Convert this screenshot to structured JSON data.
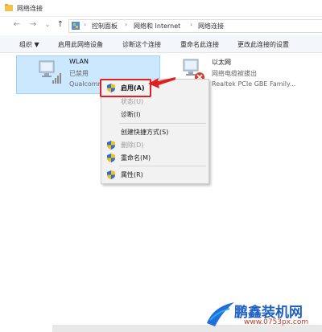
{
  "window": {
    "title": "网络连接"
  },
  "nav": {
    "back": "←",
    "forward": "→",
    "dropdown": "⌄",
    "up": "↑",
    "breadcrumb": [
      "控制面板",
      "网络和 Internet",
      "网络连接"
    ]
  },
  "toolbar": {
    "organize": "组织 ▼",
    "enable_device": "启用此网络设备",
    "diagnose": "诊断这个连接",
    "rename": "重命名此连接",
    "change_settings": "更改此连接的设置"
  },
  "connections": [
    {
      "name": "WLAN",
      "status": "已禁用",
      "adapter": "Qualcomm"
    },
    {
      "name": "以太网",
      "status": "网络电缆被拔出",
      "adapter": "Realtek PCIe GBE Family..."
    }
  ],
  "context_menu": {
    "enable": "启用(A)",
    "status": "状态(U)",
    "diagnose": "诊断(I)",
    "create_shortcut": "创建快捷方式(S)",
    "delete": "删除(D)",
    "rename": "重命名(M)",
    "properties": "属性(R)"
  },
  "watermark": {
    "brand": "鹏鑫装机网",
    "url": "www.0753px.com"
  },
  "colors": {
    "highlight": "#e02020",
    "selection": "#cce8ff",
    "shield_blue": "#2d6fd0",
    "shield_yellow": "#f2c21b"
  }
}
